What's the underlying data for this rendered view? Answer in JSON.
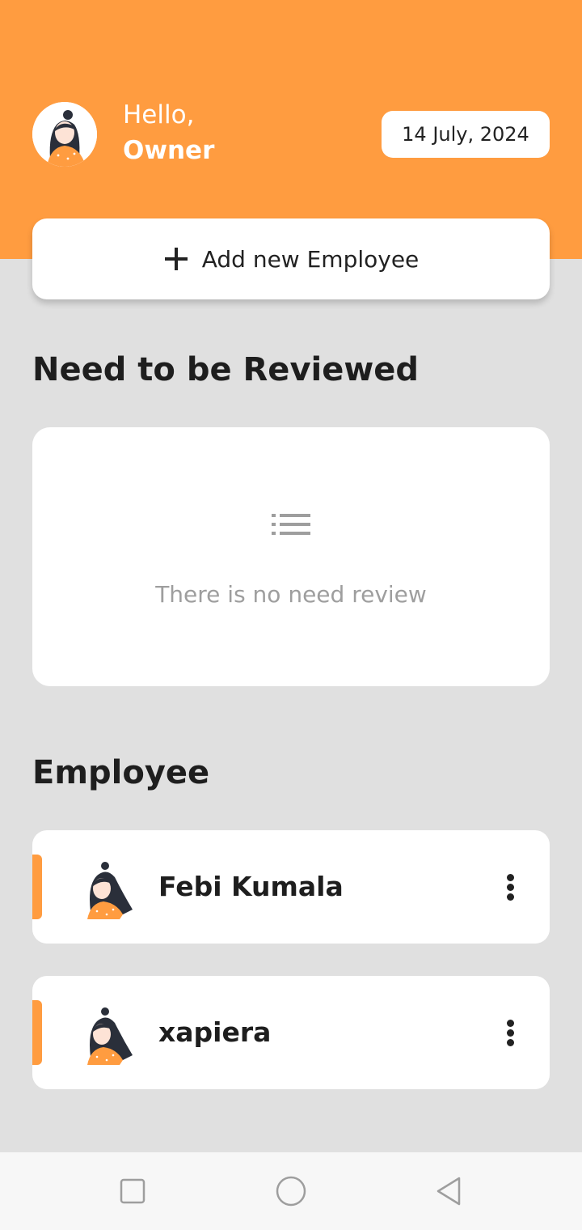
{
  "header": {
    "greeting": "Hello,",
    "user_name": "Owner",
    "date": "14 July, 2024",
    "accent_color": "#ff9c40"
  },
  "actions": {
    "add_employee_label": "Add new Employee",
    "add_icon": "plus-icon"
  },
  "review": {
    "title": "Need to be Reviewed",
    "empty_icon": "list-icon",
    "empty_text": "There is no need review"
  },
  "employees": {
    "title": "Employee",
    "items": [
      {
        "name": "Febi Kumala",
        "avatar": "avatar-illustration",
        "menu_icon": "more-vertical-icon"
      },
      {
        "name": "xapiera",
        "avatar": "avatar-illustration",
        "menu_icon": "more-vertical-icon"
      }
    ]
  },
  "system_nav": {
    "buttons": [
      "recent-apps-icon",
      "home-icon",
      "back-icon"
    ]
  }
}
